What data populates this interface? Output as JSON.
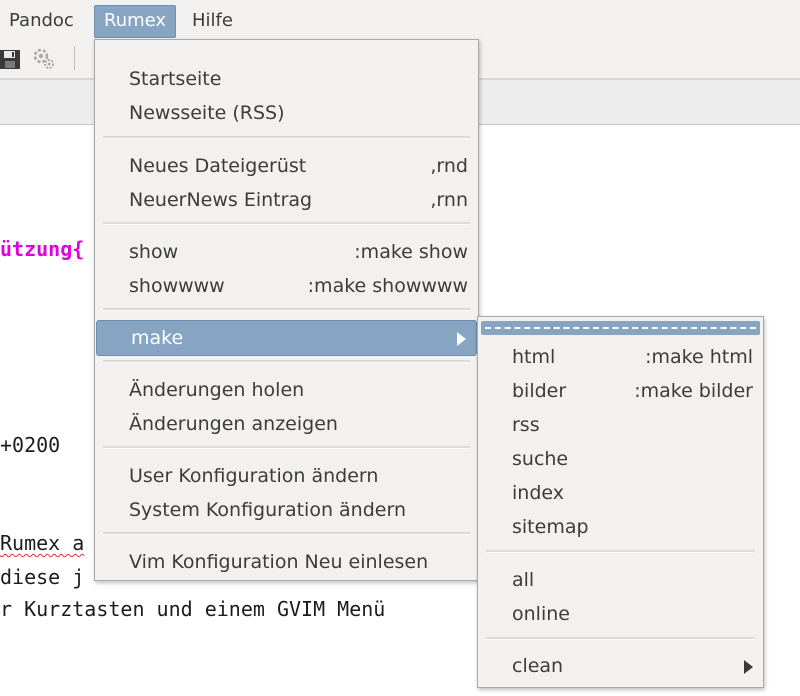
{
  "menubar": {
    "items": [
      {
        "label": "Pandoc"
      },
      {
        "label": "Rumex"
      },
      {
        "label": "Hilfe"
      }
    ]
  },
  "editor": {
    "lines": [
      {
        "text": "ützung{"
      },
      {
        "text": "+0200"
      },
      {
        "text": "Rumex a"
      },
      {
        "text": "diese j"
      },
      {
        "text": "r Kurztasten und einem GVIM Menü"
      }
    ]
  },
  "rumex_menu": {
    "items": [
      {
        "label": "Startseite",
        "accel": ""
      },
      {
        "label": "Newsseite (RSS)",
        "accel": ""
      },
      {
        "label": "Neues Dateigerüst",
        "accel": ",rnd"
      },
      {
        "label": "NeuerNews Eintrag",
        "accel": ",rnn"
      },
      {
        "label": "show",
        "accel": ":make show"
      },
      {
        "label": "showwww",
        "accel": ":make showwww"
      },
      {
        "label": "make",
        "accel": ""
      },
      {
        "label": "Änderungen holen",
        "accel": ""
      },
      {
        "label": "Änderungen anzeigen",
        "accel": ""
      },
      {
        "label": "User Konfiguration ändern",
        "accel": ""
      },
      {
        "label": "System Konfiguration ändern",
        "accel": ""
      },
      {
        "label": "Vim Konfiguration Neu einlesen",
        "accel": ""
      }
    ]
  },
  "make_menu": {
    "items": [
      {
        "label": "html",
        "accel": ":make html"
      },
      {
        "label": "bilder",
        "accel": ":make bilder"
      },
      {
        "label": "rss",
        "accel": ""
      },
      {
        "label": "suche",
        "accel": ""
      },
      {
        "label": "index",
        "accel": ""
      },
      {
        "label": "sitemap",
        "accel": ""
      },
      {
        "label": "all",
        "accel": ""
      },
      {
        "label": "online",
        "accel": ""
      },
      {
        "label": "clean",
        "accel": ""
      }
    ]
  },
  "icons": {
    "toolbar": [
      "save-icon",
      "settings-icon"
    ],
    "submenu_arrow": "chevron-right-icon"
  },
  "colors": {
    "highlight": "#87a4c2",
    "menu_bg": "#f2f1f0",
    "magenta_text": "#e000e0"
  }
}
